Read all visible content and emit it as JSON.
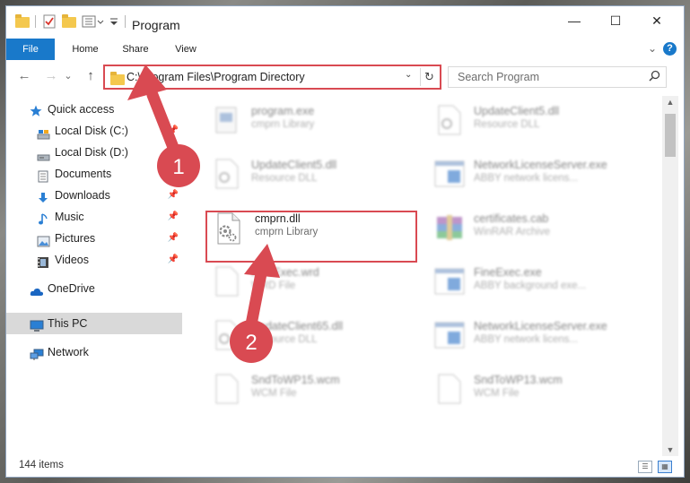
{
  "window": {
    "title": "Program",
    "minimize": "—",
    "maximize": "☐",
    "close": "✕"
  },
  "ribbon": {
    "tabs": [
      "File",
      "Home",
      "Share",
      "View"
    ],
    "expand": "⌄",
    "help": "?"
  },
  "address": {
    "back": "←",
    "forward": "→",
    "recent": "⌄",
    "up": "↑",
    "path": "C:\\Program Files\\Program Directory",
    "dropdown": "⌄",
    "refresh": "↻"
  },
  "search": {
    "placeholder": "Search Program"
  },
  "nav": {
    "items": [
      {
        "label": "Quick access",
        "icon": "star-icon"
      },
      {
        "label": "Local Disk (C:)",
        "icon": "drive-icon"
      },
      {
        "label": "Local Disk (D:)",
        "icon": "drive-icon"
      },
      {
        "label": "Documents",
        "icon": "documents-icon"
      },
      {
        "label": "Downloads",
        "icon": "download-icon"
      },
      {
        "label": "Music",
        "icon": "music-icon"
      },
      {
        "label": "Pictures",
        "icon": "pictures-icon"
      },
      {
        "label": "Videos",
        "icon": "videos-icon"
      },
      {
        "label": "OneDrive",
        "icon": "cloud-icon"
      },
      {
        "label": "This PC",
        "icon": "computer-icon"
      },
      {
        "label": "Network",
        "icon": "network-icon"
      }
    ],
    "pin": "📌"
  },
  "files": [
    {
      "name": "program.exe",
      "type": "cmprn Library",
      "icon": "exe-icon"
    },
    {
      "name": "UpdateClient5.dll",
      "type": "Resource DLL",
      "icon": "dll-icon"
    },
    {
      "name": "UpdateClient5.dll",
      "type": "Resource DLL",
      "icon": "dll-icon"
    },
    {
      "name": "NetworkLicenseServer.exe",
      "type": "ABBY network licens...",
      "icon": "app-icon"
    },
    {
      "name": "cmprn.dll",
      "type": "cmprn Library",
      "icon": "dll-icon"
    },
    {
      "name": "certificates.cab",
      "type": "WinRAR Archive",
      "icon": "archive-icon"
    },
    {
      "name": "FineExec.wrd",
      "type": "WRD File",
      "icon": "file-icon"
    },
    {
      "name": "FineExec.exe",
      "type": "ABBY background exe...",
      "icon": "app-icon"
    },
    {
      "name": "UpdateClient65.dll",
      "type": "Resource DLL",
      "icon": "dll-icon"
    },
    {
      "name": "NetworkLicenseServer.exe",
      "type": "ABBY network licens...",
      "icon": "app-icon"
    },
    {
      "name": "SndToWP15.wcm",
      "type": "WCM File",
      "icon": "file-icon"
    },
    {
      "name": "SndToWP13.wcm",
      "type": "WCM File",
      "icon": "file-icon"
    }
  ],
  "status": {
    "count": "144 items"
  },
  "annotations": {
    "step1": "1",
    "step2": "2",
    "color": "#d94a52"
  }
}
